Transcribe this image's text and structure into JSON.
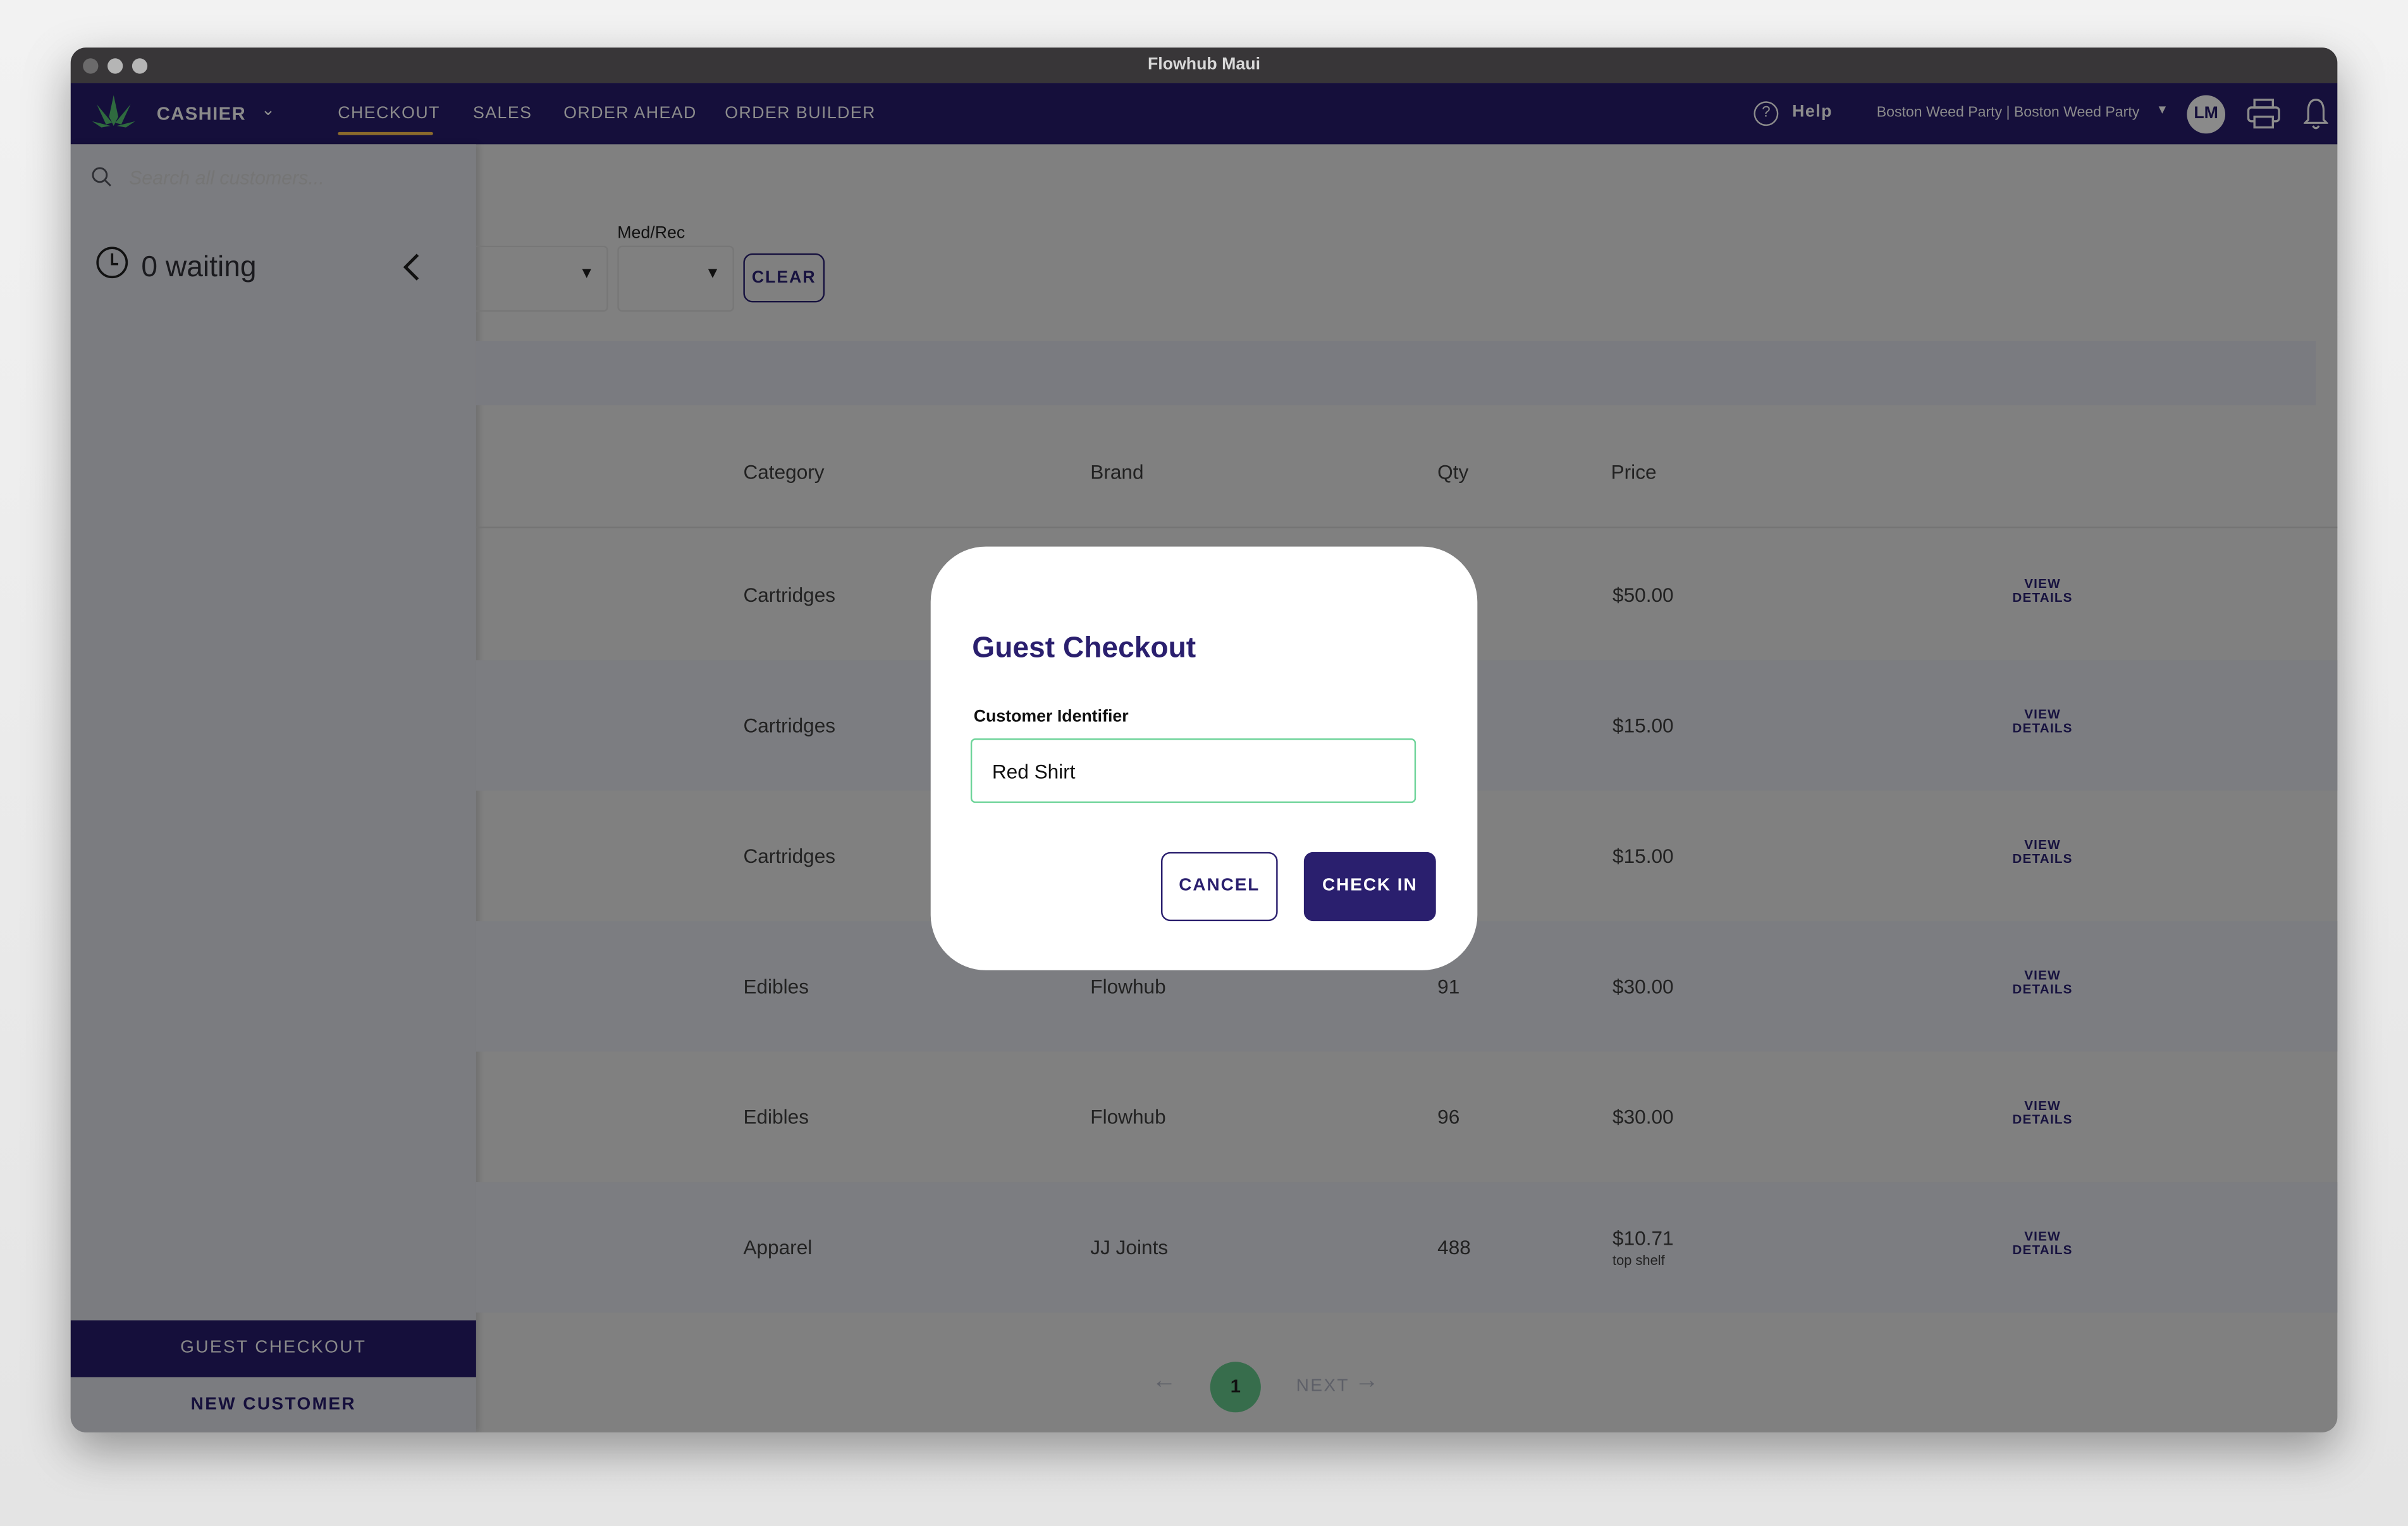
{
  "window": {
    "title": "Flowhub Maui"
  },
  "nav": {
    "role": "CASHIER",
    "tabs": [
      {
        "label": "CHECKOUT",
        "active": true
      },
      {
        "label": "SALES"
      },
      {
        "label": "ORDER AHEAD"
      },
      {
        "label": "ORDER BUILDER"
      }
    ],
    "help": "Help",
    "location": "Boston Weed Party | Boston Weed Party",
    "avatar": "LM"
  },
  "sidebar": {
    "search_placeholder": "Search all customers...",
    "waiting": "0 waiting",
    "guest_checkout": "GUEST CHECKOUT",
    "new_customer": "NEW CUSTOMER"
  },
  "filters": {
    "medrec_label": "Med/Rec",
    "clear": "CLEAR"
  },
  "table": {
    "headers": [
      "Category",
      "Brand",
      "Qty",
      "Price"
    ],
    "rows": [
      {
        "category": "Cartridges",
        "brand": "",
        "qty": "",
        "price": "$50.00",
        "note": "",
        "action": "VIEW DETAILS"
      },
      {
        "category": "Cartridges",
        "brand": "",
        "qty": "",
        "price": "$15.00",
        "note": "",
        "action": "VIEW DETAILS"
      },
      {
        "category": "Cartridges",
        "brand": "",
        "qty": "",
        "price": "$15.00",
        "note": "",
        "action": "VIEW DETAILS"
      },
      {
        "category": "Edibles",
        "brand": "Flowhub",
        "qty": "91",
        "price": "$30.00",
        "note": "",
        "action": "VIEW DETAILS"
      },
      {
        "category": "Edibles",
        "brand": "Flowhub",
        "qty": "96",
        "price": "$30.00",
        "note": "",
        "action": "VIEW DETAILS"
      },
      {
        "category": "Apparel",
        "brand": "JJ Joints",
        "qty": "488",
        "price": "$10.71",
        "note": "top shelf",
        "action": "VIEW DETAILS"
      }
    ]
  },
  "pagination": {
    "current": "1",
    "next": "NEXT"
  },
  "modal": {
    "title": "Guest Checkout",
    "field_label": "Customer Identifier",
    "field_value": "Red Shirt",
    "cancel": "CANCEL",
    "confirm": "CHECK IN"
  },
  "colors": {
    "brand": "#2a1f6e",
    "accent_green": "#3a7a4c",
    "input_focus": "#6fd49a"
  }
}
